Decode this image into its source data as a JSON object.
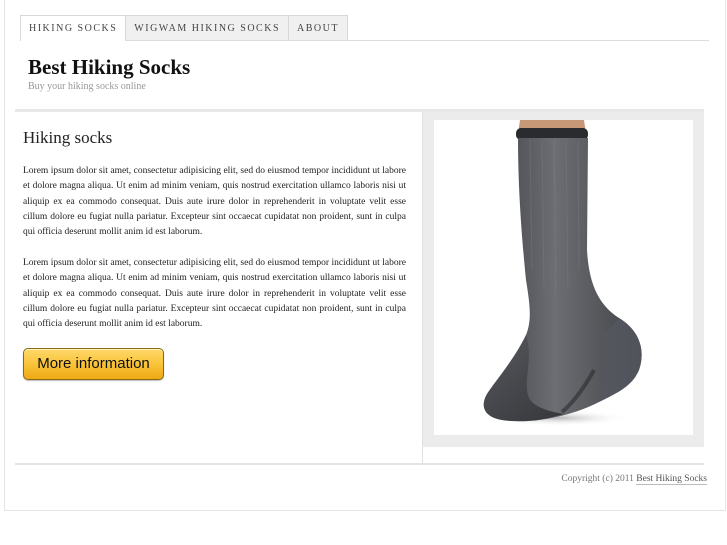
{
  "nav": {
    "items": [
      {
        "label": "HIKING SOCKS"
      },
      {
        "label": "WIGWAM HIKING SOCKS"
      },
      {
        "label": "ABOUT"
      }
    ]
  },
  "header": {
    "title": "Best Hiking Socks",
    "tagline": "Buy your hiking socks online"
  },
  "main": {
    "heading": "Hiking socks",
    "paragraphs": [
      "Lorem ipsum dolor sit amet, consectetur adipisicing elit, sed do eiusmod tempor incididunt ut labore et dolore magna aliqua. Ut enim ad minim veniam, quis nostrud exercitation ullamco laboris nisi ut aliquip ex ea commodo consequat. Duis aute irure dolor in reprehenderit in voluptate velit esse cillum dolore eu fugiat nulla pariatur. Excepteur sint occaecat cupidatat non proident, sunt in culpa qui officia deserunt mollit anim id est laborum.",
      "Lorem ipsum dolor sit amet, consectetur adipisicing elit, sed do eiusmod tempor incididunt ut labore et dolore magna aliqua. Ut enim ad minim veniam, quis nostrud exercitation ullamco laboris nisi ut aliquip ex ea commodo consequat. Duis aute irure dolor in reprehenderit in voluptate velit esse cillum dolore eu fugiat nulla pariatur. Excepteur sint occaecat cupidatat non proident, sunt in culpa qui officia deserunt mollit anim id est laborum."
    ],
    "button_label": "More information",
    "button_color": "#f9c43a"
  },
  "sidebar": {
    "image": "grey-hiking-sock-photo"
  },
  "footer": {
    "copyright": "Copyright (c) 2011",
    "link": "Best Hiking Socks"
  }
}
